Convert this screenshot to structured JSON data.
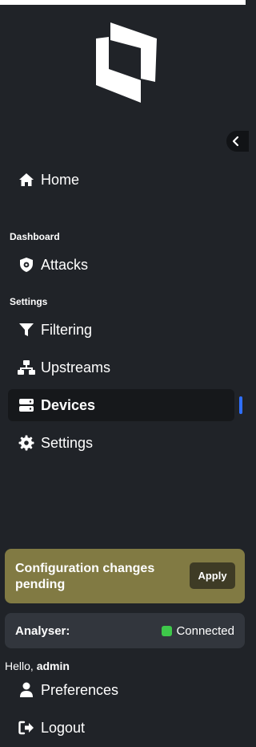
{
  "brand": {
    "logo_icon": "boxed-shield-logo"
  },
  "sidebar": {
    "collapse_icon": "chevron-left-icon",
    "home": {
      "label": "Home",
      "icon": "home-icon"
    },
    "sections": {
      "dashboard": "Dashboard",
      "settings": "Settings"
    },
    "items": [
      {
        "label": "Attacks",
        "icon": "shield-gear-icon"
      },
      {
        "label": "Filtering",
        "icon": "filter-icon"
      },
      {
        "label": "Upstreams",
        "icon": "network-icon"
      },
      {
        "label": "Devices",
        "icon": "server-icon",
        "active": true
      },
      {
        "label": "Settings",
        "icon": "gear-icon"
      }
    ]
  },
  "pending": {
    "message": "Configuration changes pending",
    "apply_label": "Apply",
    "color": "#817a43"
  },
  "analyser": {
    "label": "Analyser:",
    "status": "Connected",
    "status_color": "#3ec84a"
  },
  "user": {
    "greeting": "Hello,",
    "name": "admin",
    "preferences_label": "Preferences",
    "logout_label": "Logout"
  },
  "colors": {
    "background": "#202328",
    "active_item": "#16181b",
    "scroll_indicator": "#2f6fff"
  }
}
